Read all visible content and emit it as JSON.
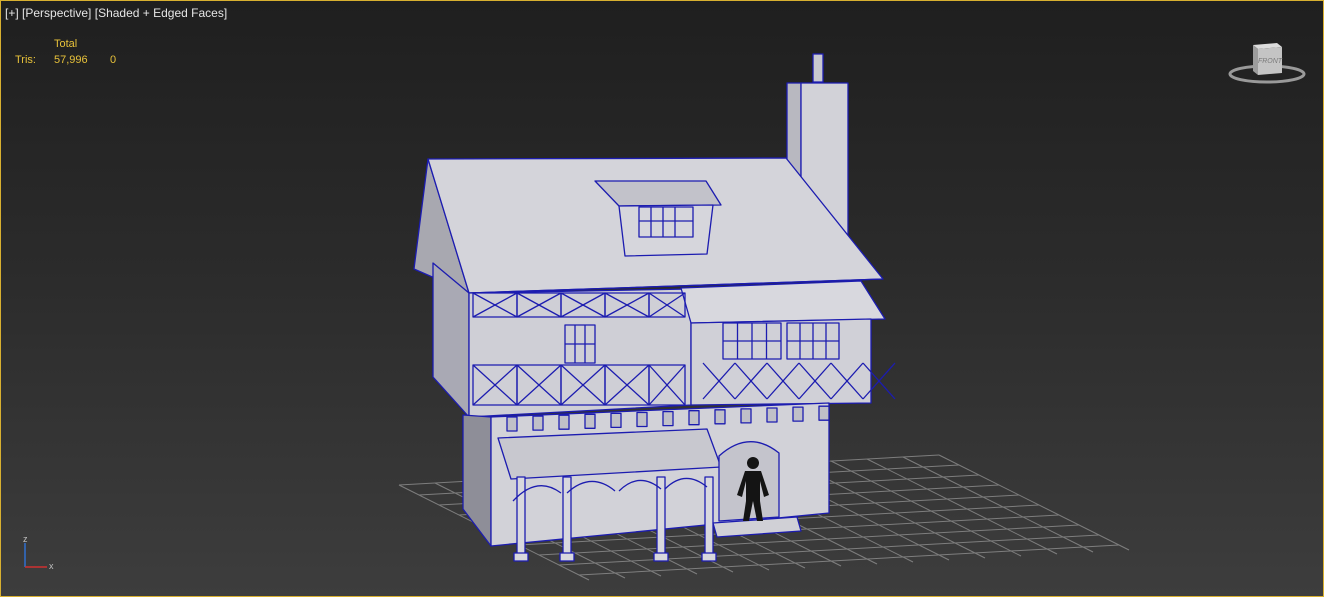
{
  "viewport": {
    "label_parts": [
      "[+]",
      "[Perspective]",
      "[Shaded + Edged Faces]"
    ],
    "border_color": "#d8b030"
  },
  "stats": {
    "header": "Total",
    "rows": [
      {
        "label": "Tris:",
        "total": "57,996",
        "selected": "0"
      }
    ],
    "text_color": "#e8c23a"
  },
  "viewcube": {
    "face_label": "FRONT",
    "icon": "viewcube-icon"
  },
  "axis_tripod": {
    "x_label": "x",
    "z_label": "z",
    "x_color": "#d03030",
    "z_color": "#3070d0"
  },
  "scene": {
    "object": "timber-framed-house",
    "edge_color": "#1c1cb0",
    "face_color": "#c9c9cf",
    "grid_color": "#8a8a8a"
  }
}
